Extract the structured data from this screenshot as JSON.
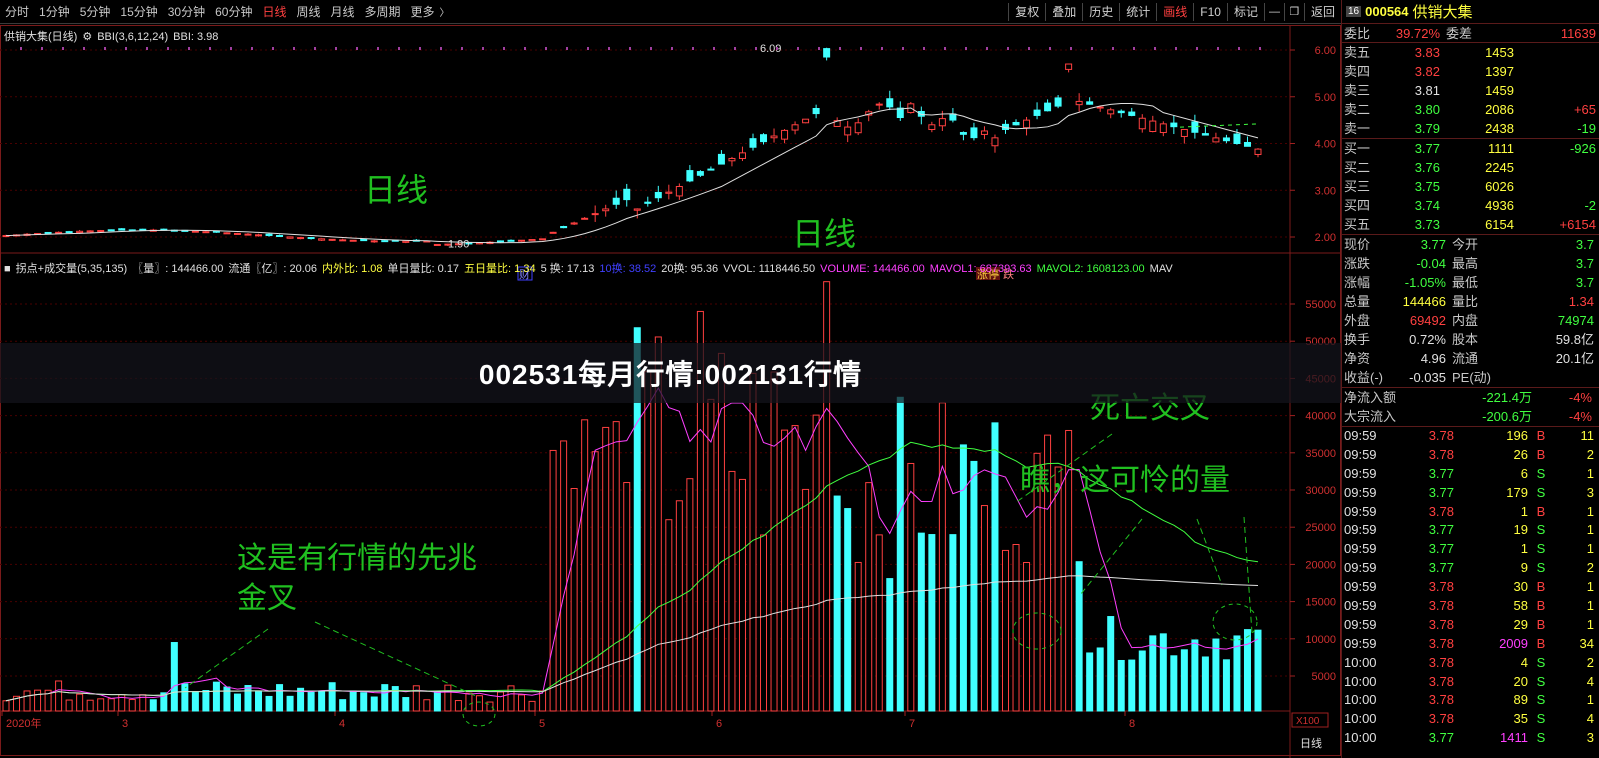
{
  "toolbar": {
    "timeframes": [
      "分时",
      "1分钟",
      "5分钟",
      "15分钟",
      "30分钟",
      "60分钟",
      "日线",
      "周线",
      "月线",
      "多周期",
      "更多"
    ],
    "active_timeframe": "日线",
    "right_tools": [
      "复权",
      "叠加",
      "历史",
      "统计",
      "画线",
      "F10",
      "标记"
    ],
    "highlighted_tool": "画线",
    "back_label": "返回"
  },
  "main_chart": {
    "header": {
      "name": "供销大集(日线)",
      "indicator": "BBI(3,6,12,24)",
      "bbi_value": "BBI: 3.98"
    },
    "y_ticks": [
      "6.00",
      "5.00",
      "4.00",
      "3.00",
      "2.00"
    ],
    "high_label": "6.09",
    "low_label": "1.90",
    "annotation_1": "日线",
    "annotation_2": "日线",
    "marker_cai": "财",
    "marker_zhangting": "涨停",
    "marker_limit": "跌"
  },
  "volume_chart": {
    "info": [
      {
        "text": "拐点+成交量(5,35,135)",
        "color": "w"
      },
      {
        "text": "〖量〗: 144466.00",
        "color": "w"
      },
      {
        "text": "流通〖亿〗: 20.06",
        "color": "w"
      },
      {
        "text": "内外比: 1.08",
        "color": "y"
      },
      {
        "text": "单日量比: 0.17",
        "color": "w"
      },
      {
        "text": "五日量比: 1.34",
        "color": "y"
      },
      {
        "text": "5 换: 17.13",
        "color": "w"
      },
      {
        "text": "10换: 38.52",
        "color": "b"
      },
      {
        "text": "20换: 95.36",
        "color": "w"
      },
      {
        "text": "VVOL: 1118446.50",
        "color": "w"
      },
      {
        "text": "VOLUME: 144466.00",
        "color": "m"
      },
      {
        "text": "MAVOL1: 687393.63",
        "color": "m"
      },
      {
        "text": "MAVOL2: 1608123.00",
        "color": "g"
      },
      {
        "text": "MAV",
        "color": "w"
      }
    ],
    "y_ticks": [
      "55000",
      "50000",
      "45000",
      "40000",
      "35000",
      "30000",
      "25000",
      "20000",
      "15000",
      "10000",
      "5000"
    ],
    "scale_badge": "X100",
    "annotation_golden_1": "这是有行情的先兆",
    "annotation_golden_2": "金叉",
    "annotation_death": "死亡交叉",
    "annotation_pity": "瞧，这可怜的量",
    "x_labels": [
      "2020年",
      "3",
      "4",
      "5",
      "6",
      "7",
      "8"
    ],
    "bottom_right_tab": "日线"
  },
  "banner": {
    "text": "002531每月行情:002131行情"
  },
  "right_panel": {
    "badge": "16",
    "code": "000564",
    "name": "供销大集",
    "webi_label": "委比",
    "webi_value": "39.72%",
    "weicha_label": "委差",
    "weicha_value": "11639",
    "asks": [
      {
        "label": "卖五",
        "price": "3.83",
        "vol": "1453",
        "chg": ""
      },
      {
        "label": "卖四",
        "price": "3.82",
        "vol": "1397",
        "chg": ""
      },
      {
        "label": "卖三",
        "price": "3.81",
        "vol": "1459",
        "chg": ""
      },
      {
        "label": "卖二",
        "price": "3.80",
        "vol": "2086",
        "chg": "+65"
      },
      {
        "label": "卖一",
        "price": "3.79",
        "vol": "2438",
        "chg": "-19"
      }
    ],
    "bids": [
      {
        "label": "买一",
        "price": "3.77",
        "vol": "1111",
        "chg": "-926"
      },
      {
        "label": "买二",
        "price": "3.76",
        "vol": "2245",
        "chg": ""
      },
      {
        "label": "买三",
        "price": "3.75",
        "vol": "6026",
        "chg": ""
      },
      {
        "label": "买四",
        "price": "3.74",
        "vol": "4936",
        "chg": "-2"
      },
      {
        "label": "买五",
        "price": "3.73",
        "vol": "6154",
        "chg": "+6154"
      }
    ],
    "quote": [
      {
        "l1": "现价",
        "v1": "3.77",
        "c1": "grn",
        "l2": "今开",
        "v2": "3.7",
        "c2": "grn"
      },
      {
        "l1": "涨跌",
        "v1": "-0.04",
        "c1": "grn",
        "l2": "最高",
        "v2": "3.7",
        "c2": "grn"
      },
      {
        "l1": "涨幅",
        "v1": "-1.05%",
        "c1": "grn",
        "l2": "最低",
        "v2": "3.7",
        "c2": "grn"
      },
      {
        "l1": "总量",
        "v1": "144466",
        "c1": "yel",
        "l2": "量比",
        "v2": "1.34",
        "c2": "red"
      },
      {
        "l1": "外盘",
        "v1": "69492",
        "c1": "red",
        "l2": "内盘",
        "v2": "74974",
        "c2": "grn"
      },
      {
        "l1": "换手",
        "v1": "0.72%",
        "c1": "wht",
        "l2": "股本",
        "v2": "59.8亿",
        "c2": "wht"
      },
      {
        "l1": "净资",
        "v1": "4.96",
        "c1": "wht",
        "l2": "流通",
        "v2": "20.1亿",
        "c2": "wht"
      },
      {
        "l1": "收益(-)",
        "v1": "-0.035",
        "c1": "wht",
        "l2": "PE(动)",
        "v2": "",
        "c2": "wht"
      }
    ],
    "flows": [
      {
        "label": "净流入额",
        "value": "-221.4万",
        "pct": "-4%"
      },
      {
        "label": "大宗流入",
        "value": "-200.6万",
        "pct": "-4%"
      }
    ],
    "ticks": [
      {
        "t": "09:59",
        "p": "3.78",
        "pc": "red",
        "v": "196",
        "s": "B",
        "n": "11"
      },
      {
        "t": "09:59",
        "p": "3.78",
        "pc": "red",
        "v": "26",
        "s": "B",
        "n": "2"
      },
      {
        "t": "09:59",
        "p": "3.77",
        "pc": "grn",
        "v": "6",
        "s": "S",
        "n": "1"
      },
      {
        "t": "09:59",
        "p": "3.77",
        "pc": "grn",
        "v": "179",
        "s": "S",
        "n": "3"
      },
      {
        "t": "09:59",
        "p": "3.78",
        "pc": "red",
        "v": "1",
        "s": "B",
        "n": "1"
      },
      {
        "t": "09:59",
        "p": "3.77",
        "pc": "grn",
        "v": "19",
        "s": "S",
        "n": "1"
      },
      {
        "t": "09:59",
        "p": "3.77",
        "pc": "grn",
        "v": "1",
        "s": "S",
        "n": "1"
      },
      {
        "t": "09:59",
        "p": "3.77",
        "pc": "grn",
        "v": "9",
        "s": "S",
        "n": "2"
      },
      {
        "t": "09:59",
        "p": "3.78",
        "pc": "red",
        "v": "30",
        "s": "B",
        "n": "1"
      },
      {
        "t": "09:59",
        "p": "3.78",
        "pc": "red",
        "v": "58",
        "s": "B",
        "n": "1"
      },
      {
        "t": "09:59",
        "p": "3.78",
        "pc": "red",
        "v": "29",
        "s": "B",
        "n": "1"
      },
      {
        "t": "09:59",
        "p": "3.78",
        "pc": "red",
        "v": "2009",
        "s": "B",
        "n": "34"
      },
      {
        "t": "10:00",
        "p": "3.78",
        "pc": "red",
        "v": "4",
        "s": "S",
        "n": "2"
      },
      {
        "t": "10:00",
        "p": "3.78",
        "pc": "red",
        "v": "20",
        "s": "S",
        "n": "4"
      },
      {
        "t": "10:00",
        "p": "3.78",
        "pc": "red",
        "v": "89",
        "s": "S",
        "n": "1"
      },
      {
        "t": "10:00",
        "p": "3.78",
        "pc": "red",
        "v": "35",
        "s": "S",
        "n": "4"
      },
      {
        "t": "10:00",
        "p": "3.77",
        "pc": "grn",
        "v": "1411",
        "s": "S",
        "n": "3"
      }
    ]
  }
}
